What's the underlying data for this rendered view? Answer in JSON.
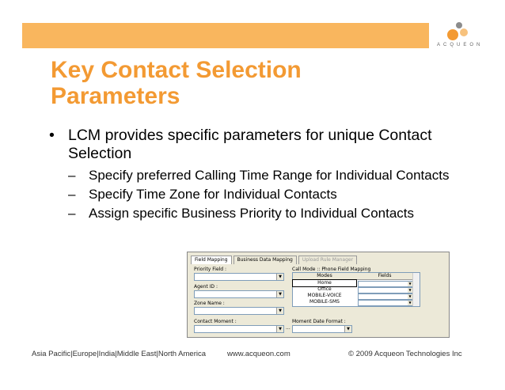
{
  "slide": {
    "title": "Key Contact Selection Parameters",
    "bullet": "LCM provides specific parameters for unique Contact Selection",
    "bullet_mark": "•",
    "sub_mark": "–",
    "sub_bullets": [
      "Specify preferred Calling Time Range for Individual Contacts",
      "Specify Time Zone for Individual Contacts",
      "Assign specific Business Priority to Individual Contacts"
    ]
  },
  "logo": {
    "wordmark": "ACQUEON",
    "colors": {
      "orange": "#F39A33",
      "gray": "#8C8C8C"
    }
  },
  "dialog": {
    "tabs": [
      "Field Mapping",
      "Business Data Mapping",
      "Upload Rule Manager"
    ],
    "priority_label": "Priority Field :",
    "agent_label": "Agent ID :",
    "zone_label": "Zone Name :",
    "contact_moment_label": "Contact Moment :",
    "moment_date_label": "Moment Date Format :",
    "call_mode_label": "Call Mode :: Phone Field Mapping",
    "grid_headers": [
      "Modes",
      "Fields"
    ],
    "modes": [
      "Home",
      "Office",
      "MOBILE-VOICE",
      "MOBILE-SMS"
    ],
    "ellipsis": "..."
  },
  "footer": {
    "regions": "Asia Pacific|Europe|India|Middle East|North America",
    "website": "www.acqueon.com",
    "copyright": "© 2009 Acqueon Technologies Inc"
  },
  "colors": {
    "band": "#F9B65E",
    "title": "#F39A33"
  }
}
